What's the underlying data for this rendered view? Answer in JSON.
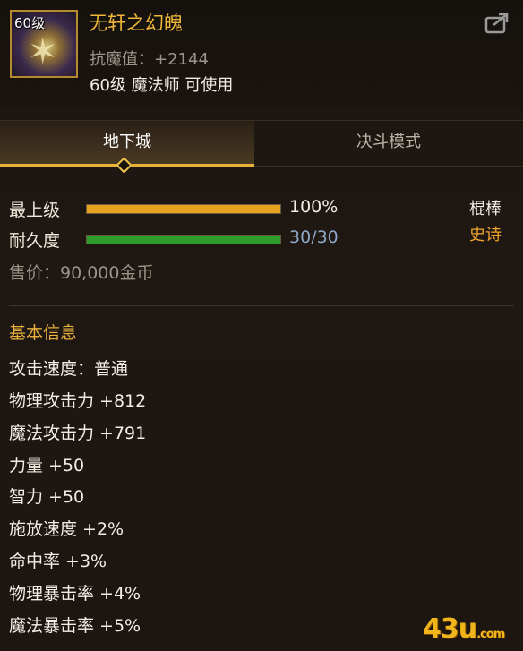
{
  "item": {
    "level_badge": "60级",
    "name": "无轩之幻魄",
    "stat": "抗魔值：+2144",
    "requirement": "60级 魔法师 可使用"
  },
  "tabs": [
    {
      "label": "地下城",
      "active": true
    },
    {
      "label": "决斗模式",
      "active": false
    }
  ],
  "bars": {
    "upgrade": {
      "label": "最上级",
      "value_text": "100%",
      "fraction": 1.0,
      "color": "#e6a21f"
    },
    "durability": {
      "label": "耐久度",
      "value_text": "30/30",
      "fraction": 1.0,
      "color": "#2f9b2a"
    }
  },
  "weapon_type": "棍棒",
  "rarity": "史诗",
  "price": "售价：90,000金币",
  "basic_info": {
    "title": "基本信息",
    "attributes": [
      "攻击速度：普通",
      "物理攻击力 +812",
      "魔法攻击力 +791",
      "力量 +50",
      "智力 +50",
      "施放速度 +2%",
      "命中率 +3%",
      "物理暴击率 +4%",
      "魔法暴击率 +5%"
    ]
  },
  "watermark": {
    "main": "43u",
    "suffix": ".com"
  },
  "colors": {
    "accent": "#e7b13c",
    "name": "#f0b83a",
    "rarity": "#f0a52a"
  }
}
